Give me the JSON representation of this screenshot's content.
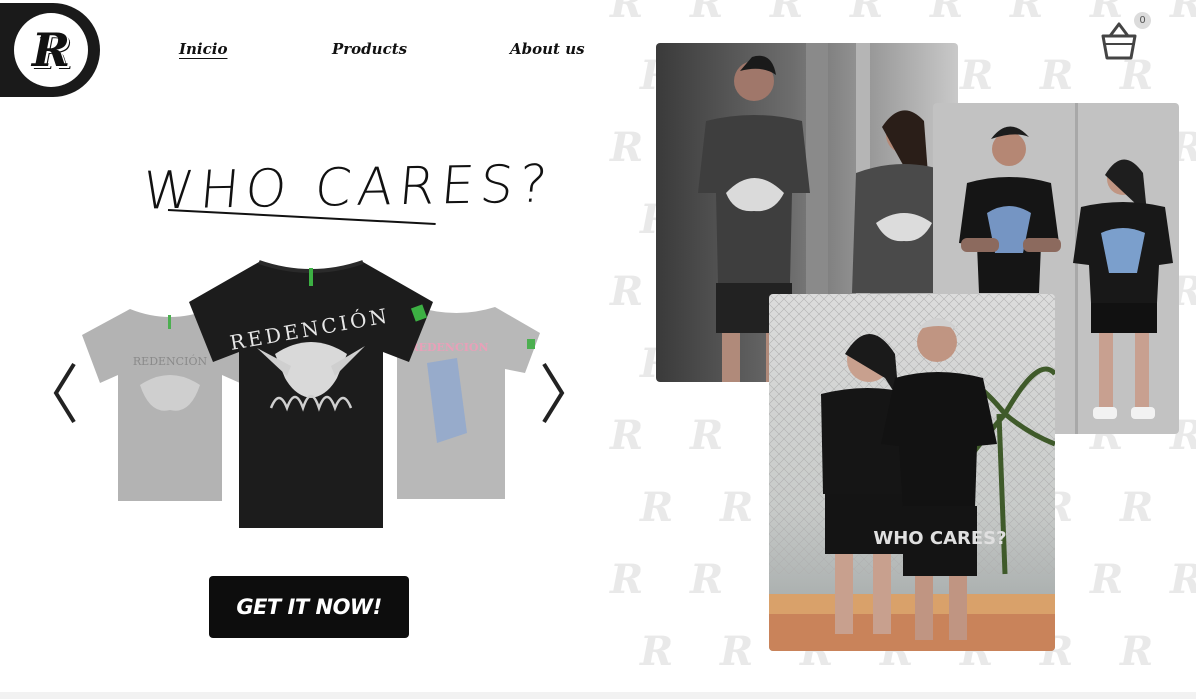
{
  "brand": {
    "logo_letter": "R"
  },
  "nav": {
    "items": [
      {
        "label": "Inicio",
        "active": true
      },
      {
        "label": "Products",
        "active": false
      },
      {
        "label": "About us",
        "active": false
      }
    ]
  },
  "cart": {
    "count": "0",
    "icon": "basket-icon"
  },
  "hero": {
    "headline": "WHO CARES?",
    "cta_label": "GET IT NOW!"
  },
  "carousel": {
    "prev_icon": "chevron-left-icon",
    "next_icon": "chevron-right-icon",
    "items": [
      {
        "print": "REDENCIÓN",
        "color": "gray",
        "state": "faded"
      },
      {
        "print": "REDENCIÓN",
        "color": "black",
        "state": "active"
      },
      {
        "print": "REDENCIÓN",
        "color": "gray",
        "state": "faded"
      }
    ]
  },
  "shorts_print": "WHO CARES?",
  "colors": {
    "accent": "#0d0d0d",
    "tag_green": "#3cb043",
    "watermark": "#e9e9e9"
  }
}
